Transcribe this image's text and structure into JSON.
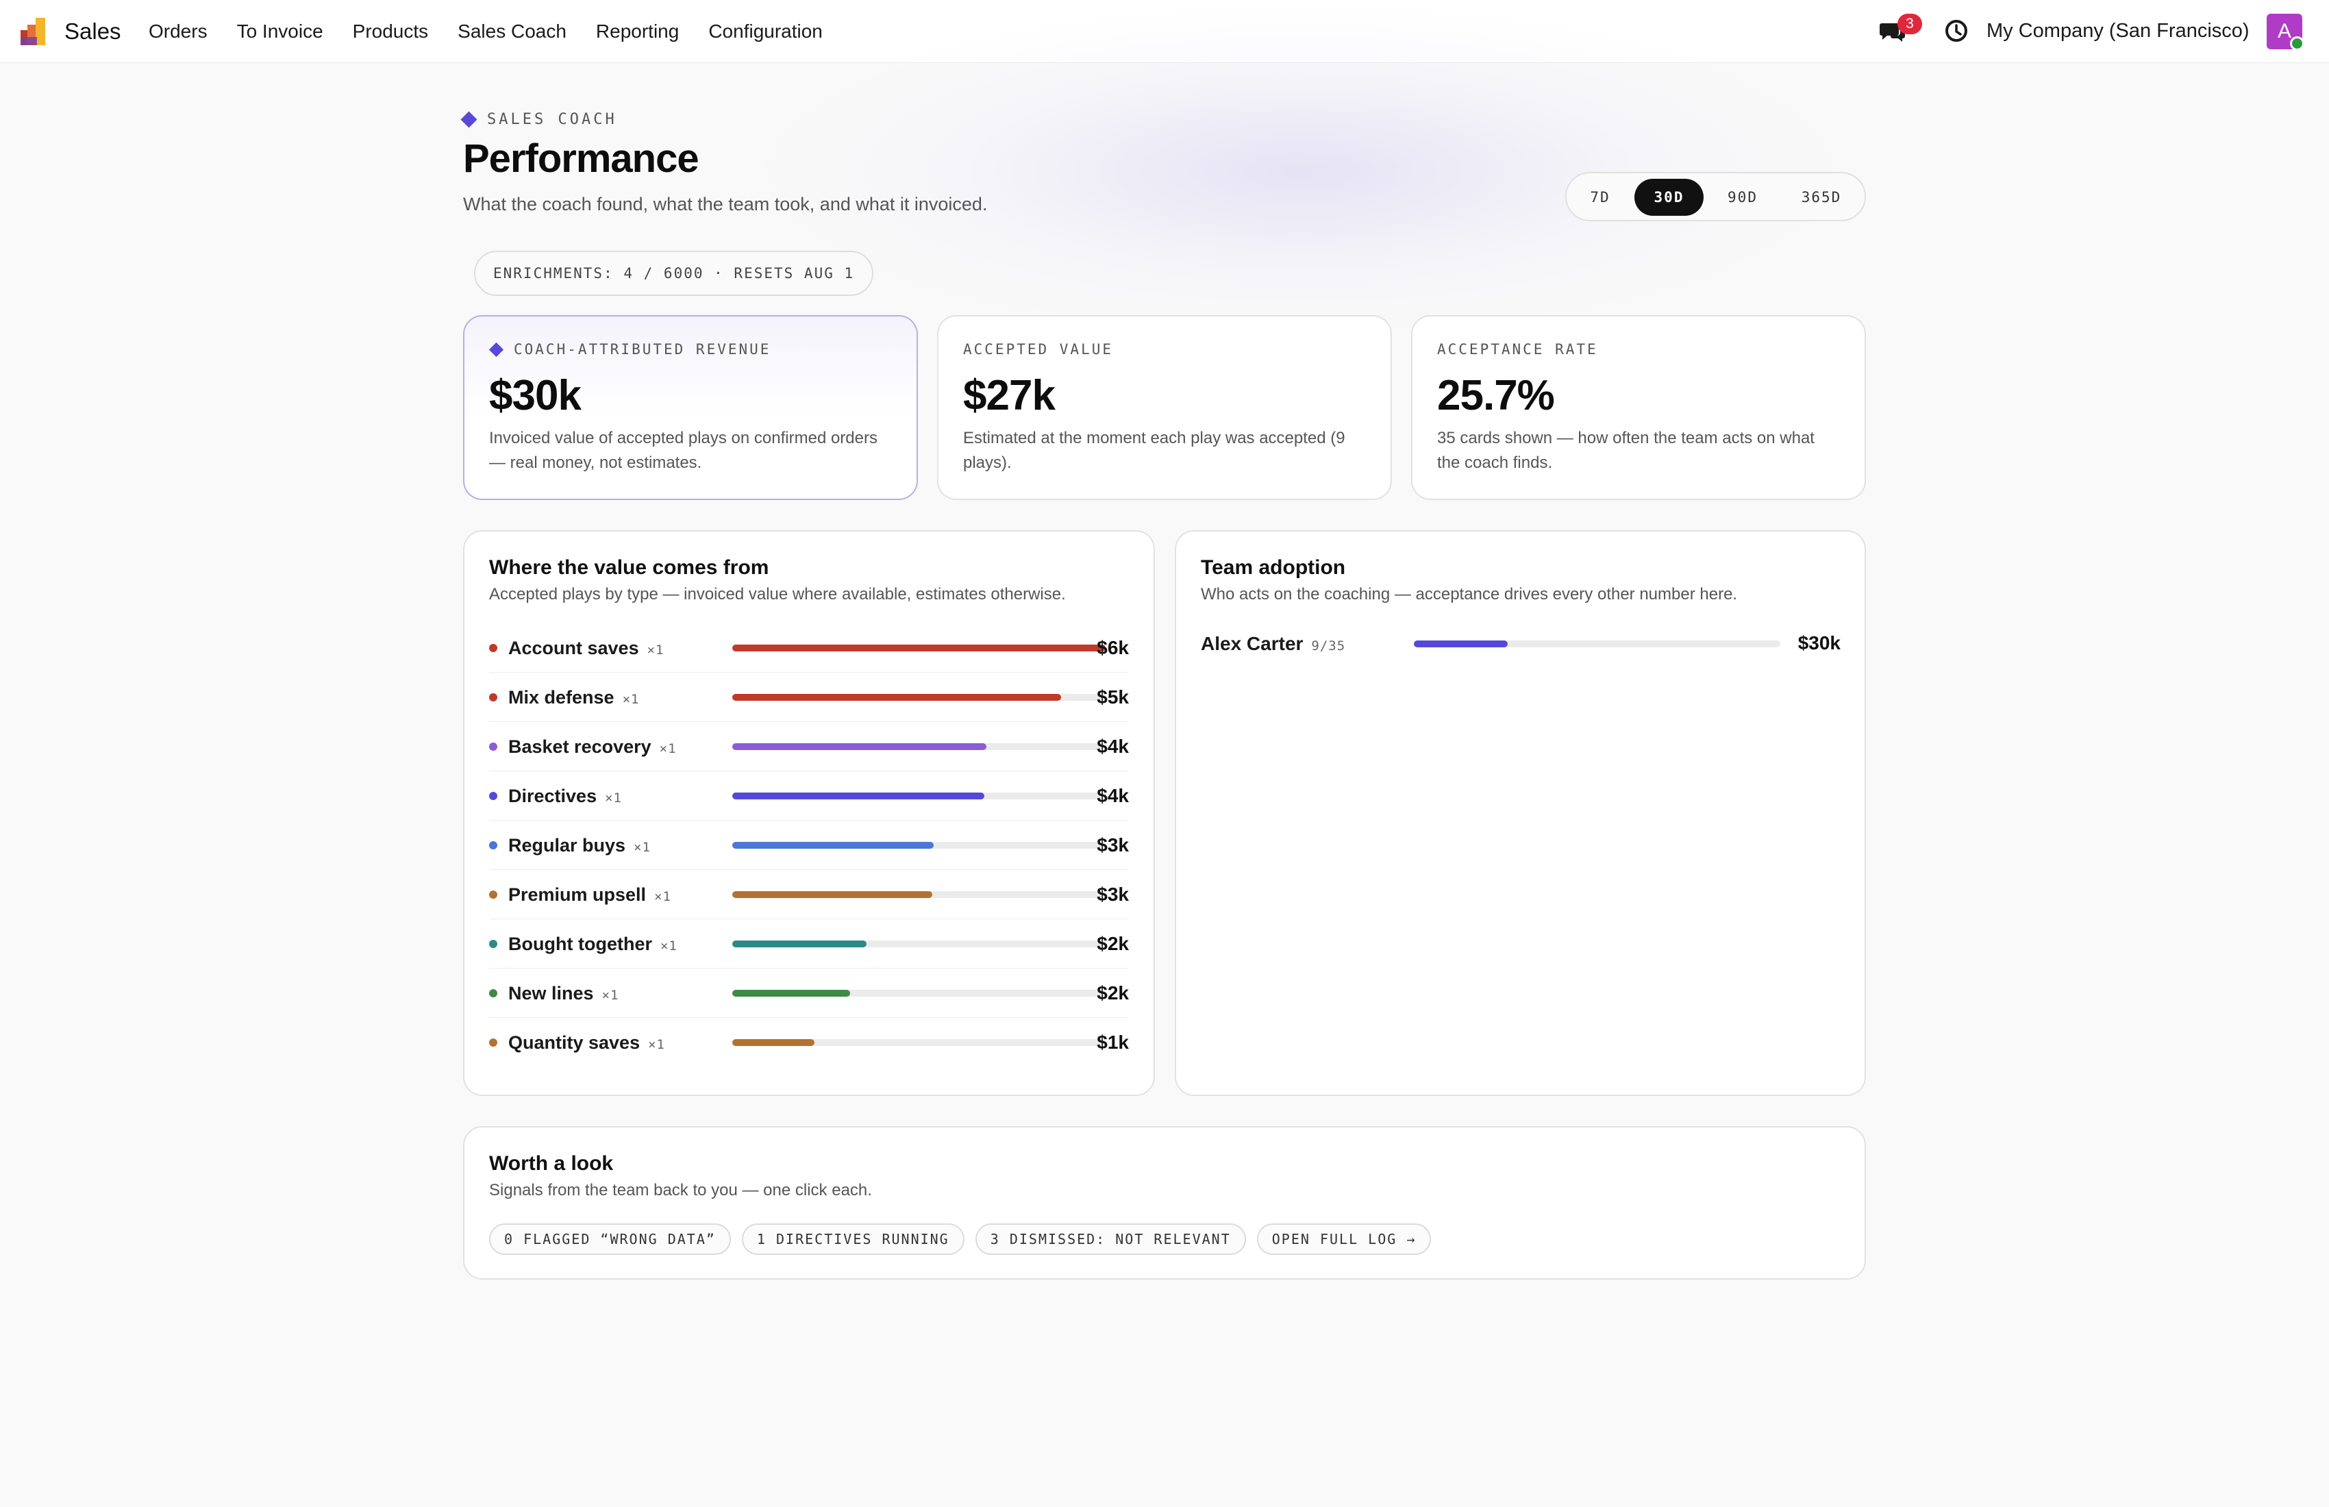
{
  "nav": {
    "app_name": "Sales",
    "menu": [
      "Orders",
      "To Invoice",
      "Products",
      "Sales Coach",
      "Reporting",
      "Configuration"
    ],
    "messages_count": "3",
    "company": "My Company (San Francisco)",
    "avatar_initial": "A",
    "icons": [
      "app-logo-icon",
      "chat-icon",
      "clock-icon"
    ]
  },
  "header": {
    "eyebrow": "SALES COACH",
    "title": "Performance",
    "subtitle": "What the coach found, what the team took, and what it invoiced.",
    "ranges": [
      "7D",
      "30D",
      "90D",
      "365D"
    ],
    "active_range": "30D",
    "enrichments": "ENRICHMENTS: 4 / 6000 · RESETS AUG 1"
  },
  "kpis": [
    {
      "label": "COACH-ATTRIBUTED REVENUE",
      "value": "$30k",
      "description": "Invoiced value of accepted plays on confirmed orders — real money, not estimates."
    },
    {
      "label": "ACCEPTED VALUE",
      "value": "$27k",
      "description": "Estimated at the moment each play was accepted (9 plays)."
    },
    {
      "label": "ACCEPTANCE RATE",
      "value": "25.7%",
      "description": "35 cards shown — how often the team acts on what the coach finds."
    }
  ],
  "value_panel": {
    "title": "Where the value comes from",
    "subtitle": "Accepted plays by type — invoiced value where available, estimates otherwise.",
    "rows": [
      {
        "label": "Account saves",
        "count": "×1",
        "amount": "$6k",
        "fraction": 1.0,
        "color": "#c0392b"
      },
      {
        "label": "Mix defense",
        "count": "×1",
        "amount": "$5k",
        "fraction": 0.88,
        "color": "#c0392b"
      },
      {
        "label": "Basket recovery",
        "count": "×1",
        "amount": "$4k",
        "fraction": 0.68,
        "color": "#8a5cd6"
      },
      {
        "label": "Directives",
        "count": "×1",
        "amount": "$4k",
        "fraction": 0.675,
        "color": "#5548d9"
      },
      {
        "label": "Regular buys",
        "count": "×1",
        "amount": "$3k",
        "fraction": 0.54,
        "color": "#4a78d4"
      },
      {
        "label": "Premium upsell",
        "count": "×1",
        "amount": "$3k",
        "fraction": 0.535,
        "color": "#b37230"
      },
      {
        "label": "Bought together",
        "count": "×1",
        "amount": "$2k",
        "fraction": 0.36,
        "color": "#2b8a86"
      },
      {
        "label": "New lines",
        "count": "×1",
        "amount": "$2k",
        "fraction": 0.315,
        "color": "#3e8a47"
      },
      {
        "label": "Quantity saves",
        "count": "×1",
        "amount": "$1k",
        "fraction": 0.22,
        "color": "#b37230"
      }
    ]
  },
  "adoption_panel": {
    "title": "Team adoption",
    "subtitle": "Who acts on the coaching — acceptance drives every other number here.",
    "members": [
      {
        "name": "Alex Carter",
        "ratio": "9/35",
        "amount": "$30k",
        "fraction": 0.257
      }
    ]
  },
  "worth_panel": {
    "title": "Worth a look",
    "subtitle": "Signals from the team back to you — one click each.",
    "chips": [
      "0 FLAGGED “WRONG DATA”",
      "1 DIRECTIVES RUNNING",
      "3 DISMISSED: NOT RELEVANT",
      "OPEN FULL LOG →"
    ]
  }
}
